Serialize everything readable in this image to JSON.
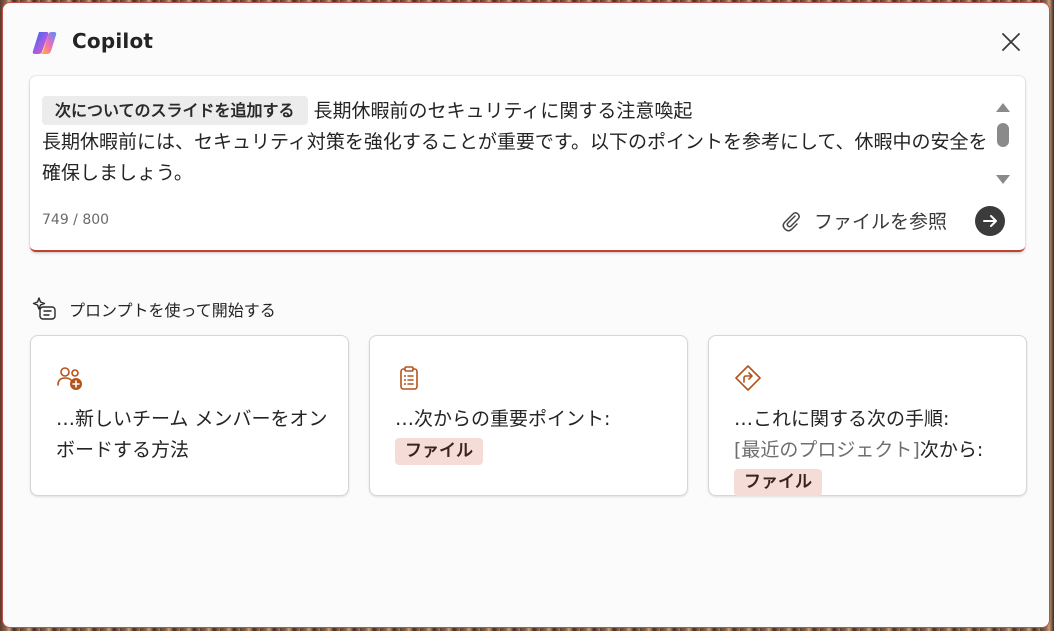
{
  "header": {
    "title": "Copilot",
    "logo_icon": "copilot-logo",
    "close_icon": "close-icon"
  },
  "composer": {
    "chip_label": "次についてのスライドを追加する",
    "line1_text": "長期休暇前のセキュリティに関する注意喚起",
    "body_text": "長期休暇前には、セキュリティ対策を強化することが重要です。以下のポイントを参考にして、休暇中の安全を確保しましょう。",
    "char_counter": "749 / 800",
    "attach_label": "ファイルを参照",
    "attach_icon": "paperclip-icon",
    "send_icon": "arrow-right-icon"
  },
  "prompts": {
    "section_title": "プロンプトを使って開始する",
    "section_icon": "prompt-sparkle-icon",
    "cards": [
      {
        "icon": "add-people-icon",
        "text": "…新しいチーム メンバーをオンボードする方法"
      },
      {
        "icon": "clipboard-icon",
        "text": "…次からの重要ポイント:",
        "chip": "ファイル"
      },
      {
        "icon": "directions-icon",
        "text": "…これに関する次の手順:",
        "placeholder": "[最近のプロジェクト]",
        "suffix": "次から:",
        "chip": "ファイル"
      }
    ]
  },
  "colors": {
    "accent": "#c4412f",
    "icon_accent": "#b5531c",
    "chip_bg": "#f6dcd6"
  }
}
